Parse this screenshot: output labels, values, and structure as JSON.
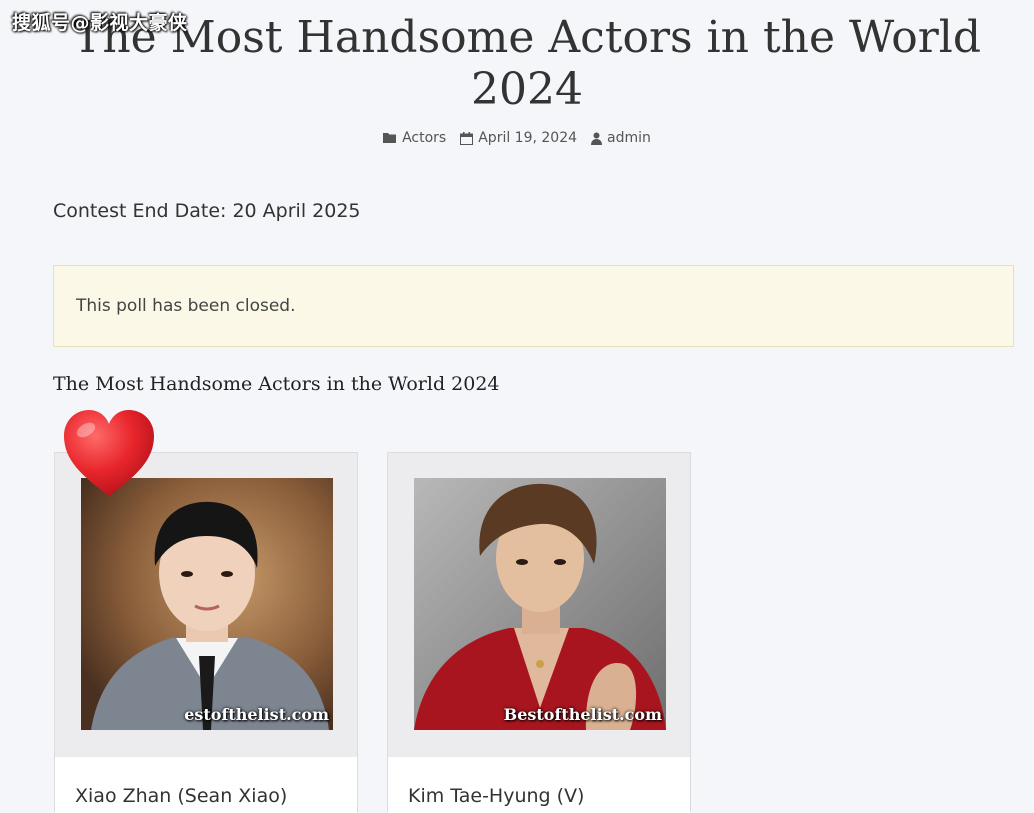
{
  "watermark": "搜狐号@影视大豪侠",
  "page": {
    "title": "The Most Handsome Actors in the World 2024"
  },
  "meta": {
    "category": "Actors",
    "date": "April 19, 2024",
    "author": "admin"
  },
  "contest_end": "Contest End Date: 20 April 2025",
  "poll_notice": "This poll has been closed.",
  "section_heading": "The Most Handsome Actors in the World 2024",
  "candidates": [
    {
      "name": "Xiao Zhan (Sean Xiao)",
      "photo_credit": "estofthelist.com",
      "favorite": true
    },
    {
      "name": "Kim Tae-Hyung (V)",
      "photo_credit": "Bestofthelist.com",
      "favorite": false
    }
  ],
  "colors": {
    "notice_bg": "#fbf8e8",
    "heart": "#e8262c"
  }
}
